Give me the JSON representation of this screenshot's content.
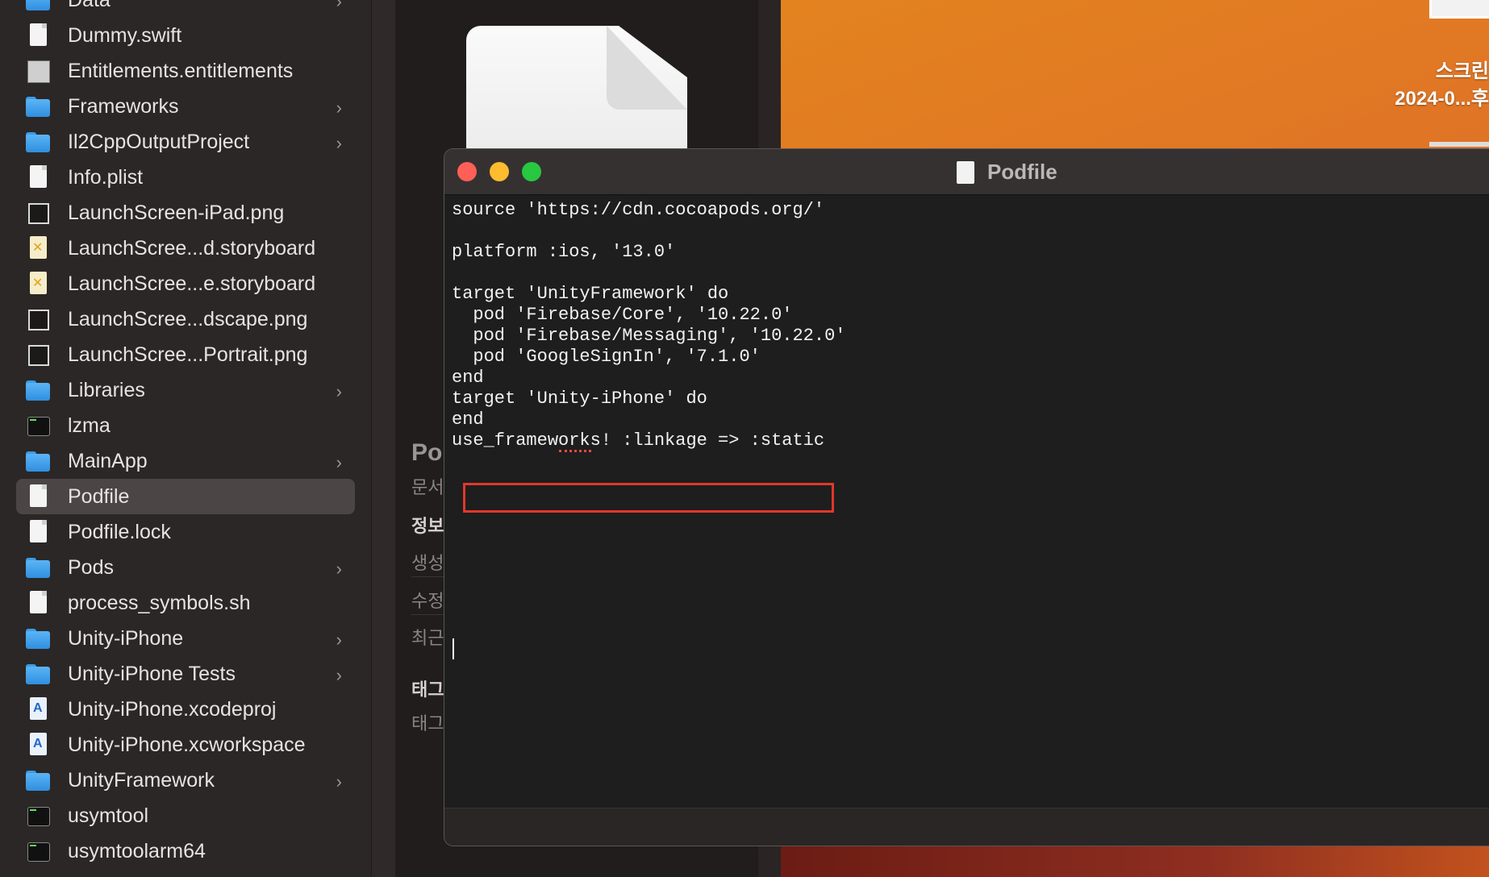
{
  "sidebar": {
    "items": [
      {
        "label": "Data",
        "icon": "folder-icon",
        "expandable": true
      },
      {
        "label": "Dummy.swift",
        "icon": "swift-file-icon",
        "expandable": false
      },
      {
        "label": "Entitlements.entitlements",
        "icon": "entitlements-file-icon",
        "expandable": false
      },
      {
        "label": "Frameworks",
        "icon": "folder-icon",
        "expandable": true
      },
      {
        "label": "Il2CppOutputProject",
        "icon": "folder-icon",
        "expandable": true
      },
      {
        "label": "Info.plist",
        "icon": "plist-file-icon",
        "expandable": false
      },
      {
        "label": "LaunchScreen-iPad.png",
        "icon": "image-file-icon",
        "expandable": false
      },
      {
        "label": "LaunchScree...d.storyboard",
        "icon": "storyboard-file-icon",
        "expandable": false
      },
      {
        "label": "LaunchScree...e.storyboard",
        "icon": "storyboard-file-icon",
        "expandable": false
      },
      {
        "label": "LaunchScree...dscape.png",
        "icon": "image-file-icon",
        "expandable": false
      },
      {
        "label": "LaunchScree...Portrait.png",
        "icon": "image-file-icon",
        "expandable": false
      },
      {
        "label": "Libraries",
        "icon": "folder-icon",
        "expandable": true
      },
      {
        "label": "lzma",
        "icon": "executable-icon",
        "expandable": false
      },
      {
        "label": "MainApp",
        "icon": "folder-icon",
        "expandable": true
      },
      {
        "label": "Podfile",
        "icon": "document-icon",
        "expandable": false,
        "selected": true
      },
      {
        "label": "Podfile.lock",
        "icon": "document-icon",
        "expandable": false
      },
      {
        "label": "Pods",
        "icon": "folder-icon",
        "expandable": true
      },
      {
        "label": "process_symbols.sh",
        "icon": "shell-script-icon",
        "expandable": false
      },
      {
        "label": "Unity-iPhone",
        "icon": "folder-icon",
        "expandable": true
      },
      {
        "label": "Unity-iPhone Tests",
        "icon": "folder-icon",
        "expandable": true
      },
      {
        "label": "Unity-iPhone.xcodeproj",
        "icon": "xcodeproj-icon",
        "expandable": false
      },
      {
        "label": "Unity-iPhone.xcworkspace",
        "icon": "xcworkspace-icon",
        "expandable": false
      },
      {
        "label": "UnityFramework",
        "icon": "folder-icon",
        "expandable": true
      },
      {
        "label": "usymtool",
        "icon": "executable-icon",
        "expandable": false
      },
      {
        "label": "usymtoolarm64",
        "icon": "executable-icon",
        "expandable": false
      }
    ],
    "chevron": "›"
  },
  "preview": {
    "title": "Po",
    "kind": "문서",
    "info_heading": "정보",
    "created_label": "생성",
    "modified_label": "수정",
    "last_opened_label": "최근",
    "tags_heading": "태그",
    "tags_placeholder": "태그"
  },
  "desktop": {
    "file_label_line1": "스크린",
    "file_label_line2": "2024-0...후"
  },
  "window": {
    "title": "Podfile",
    "code_lines": [
      "source 'https://cdn.cocoapods.org/'",
      "",
      "platform :ios, '13.0'",
      "",
      "target 'UnityFramework' do",
      "  pod 'Firebase/Core', '10.22.0'",
      "  pod 'Firebase/Messaging', '10.22.0'",
      "  pod 'GoogleSignIn', '7.1.0'",
      "end",
      "target 'Unity-iPhone' do",
      "end",
      "use_frameworks! :linkage => :static"
    ],
    "highlighted_line": 7,
    "highlight_color": "#e0382a"
  },
  "colors": {
    "close": "#fe5f57",
    "minimize": "#febc2e",
    "maximize": "#28c840",
    "folder": "#3a9ce8",
    "selection": "#4b4645"
  }
}
